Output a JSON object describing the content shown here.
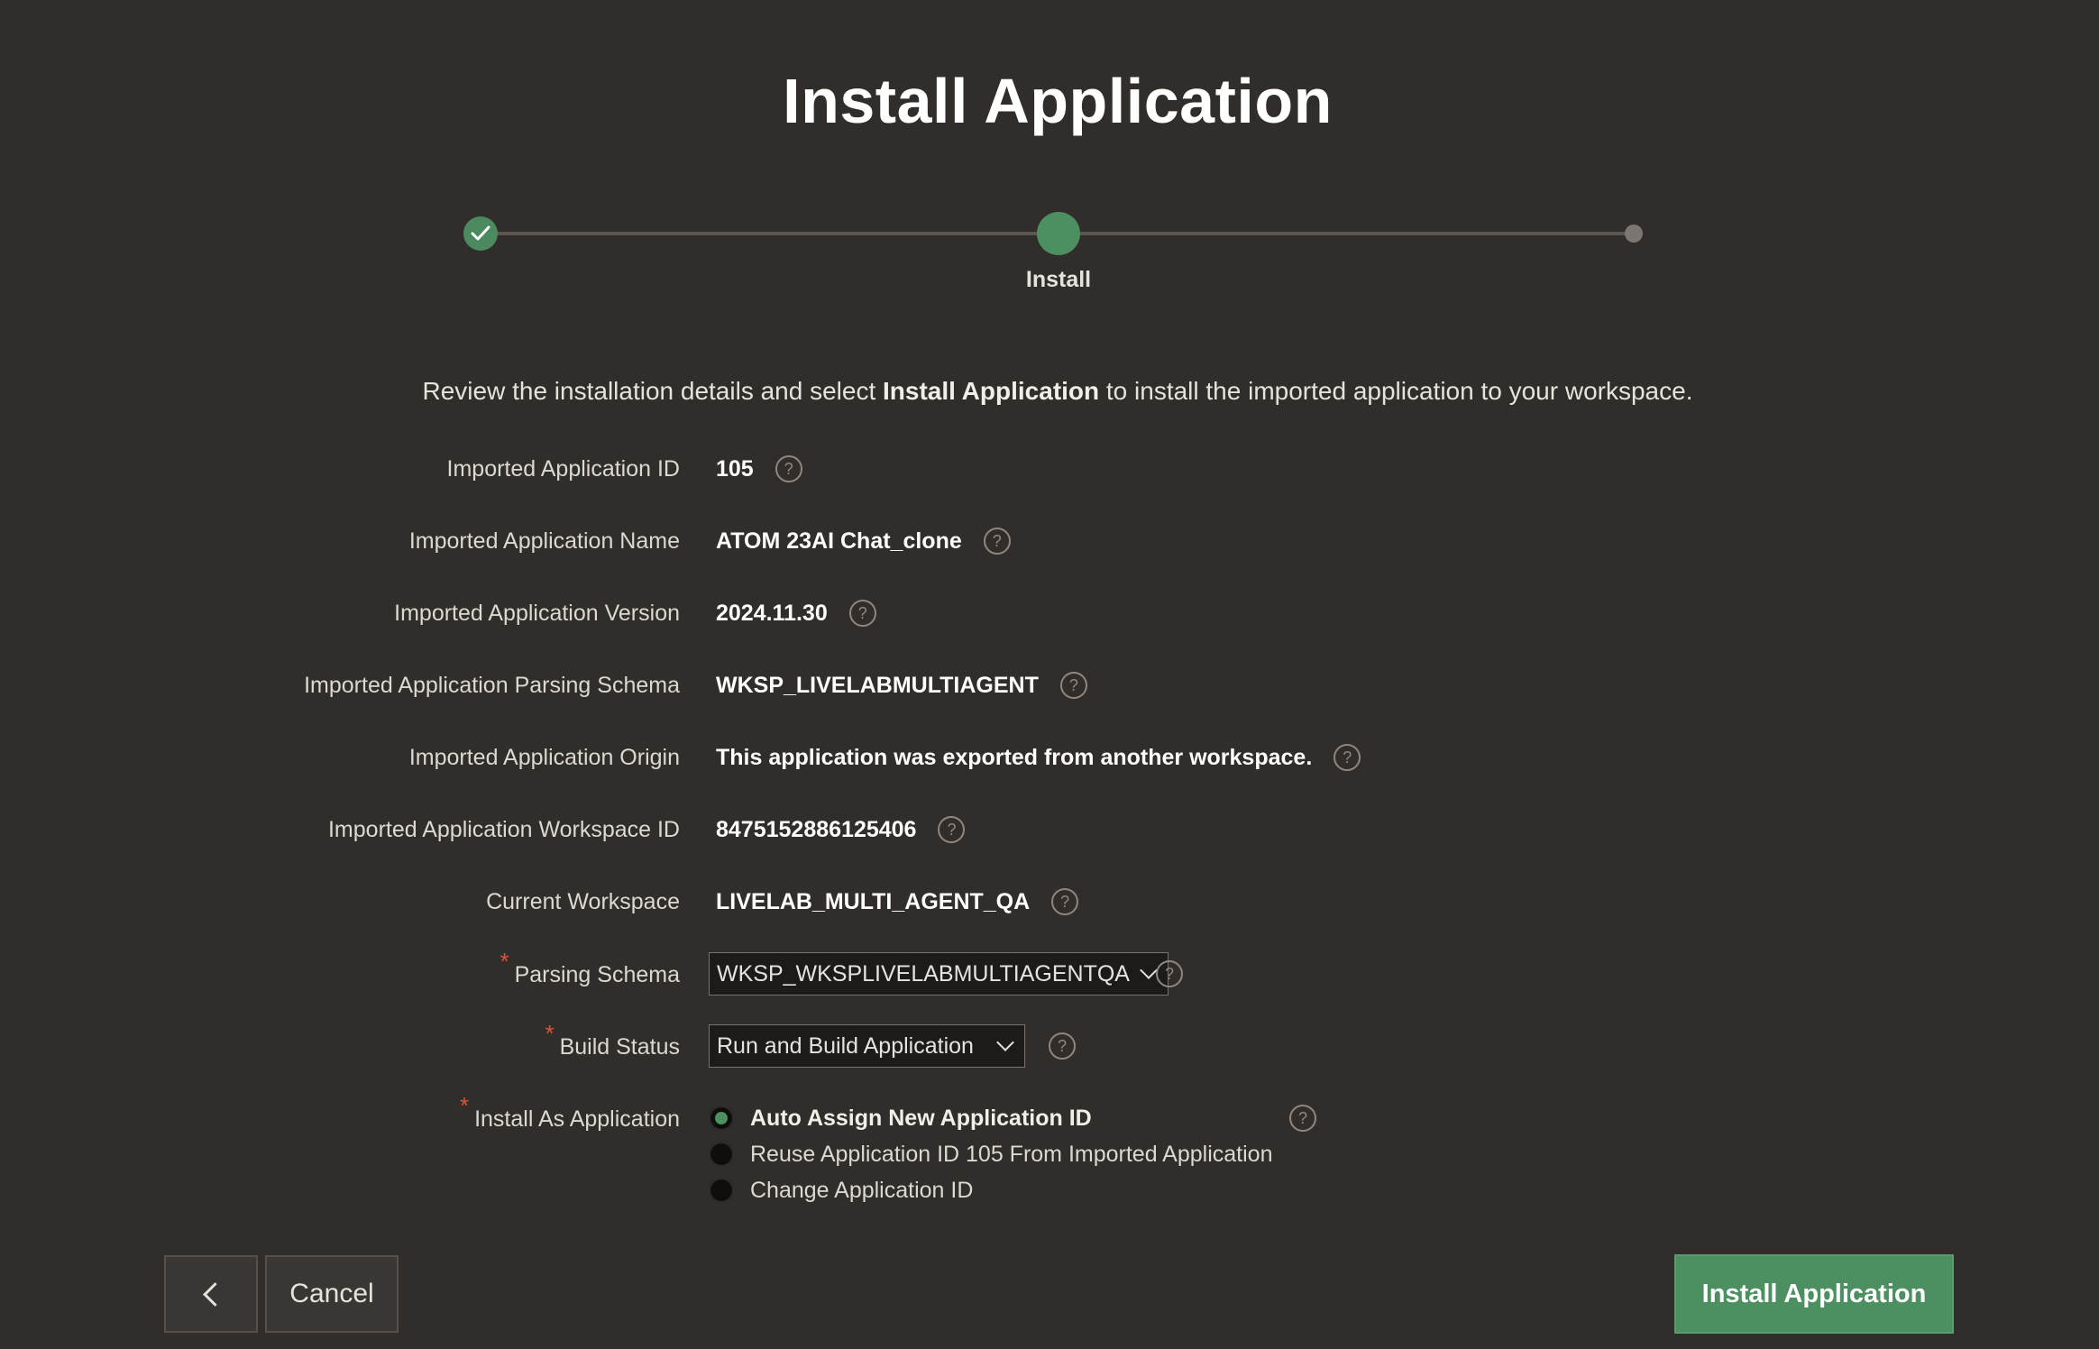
{
  "page": {
    "title": "Install Application"
  },
  "steps": {
    "current_label": "Install"
  },
  "intro": {
    "before": "Review the installation details and select ",
    "bold": "Install Application",
    "after": " to install the imported application to your workspace."
  },
  "fields": {
    "app_id": {
      "label": "Imported Application ID",
      "value": "105"
    },
    "app_name": {
      "label": "Imported Application Name",
      "value": "ATOM 23AI Chat_clone"
    },
    "app_version": {
      "label": "Imported Application Version",
      "value": "2024.11.30"
    },
    "parsing_schema_imported": {
      "label": "Imported Application Parsing Schema",
      "value": "WKSP_LIVELABMULTIAGENT"
    },
    "origin": {
      "label": "Imported Application Origin",
      "value": "This application was exported from another workspace."
    },
    "workspace_id": {
      "label": "Imported Application Workspace ID",
      "value": "8475152886125406"
    },
    "current_workspace": {
      "label": "Current Workspace",
      "value": "LIVELAB_MULTI_AGENT_QA"
    },
    "parsing_schema": {
      "label": "Parsing Schema",
      "value": "WKSP_WKSPLIVELABMULTIAGENTQA"
    },
    "build_status": {
      "label": "Build Status",
      "value": "Run and Build Application"
    },
    "install_as": {
      "label": "Install As Application",
      "options": [
        "Auto Assign New Application ID",
        "Reuse Application ID 105 From Imported Application",
        "Change Application ID"
      ],
      "selected_index": 0
    }
  },
  "common": {
    "help_glyph": "?",
    "required_mark": "*"
  },
  "buttons": {
    "cancel": "Cancel",
    "install": "Install Application"
  },
  "colors": {
    "background": "#312d2a",
    "accent": "#4c8f61",
    "required": "#d5553f"
  }
}
